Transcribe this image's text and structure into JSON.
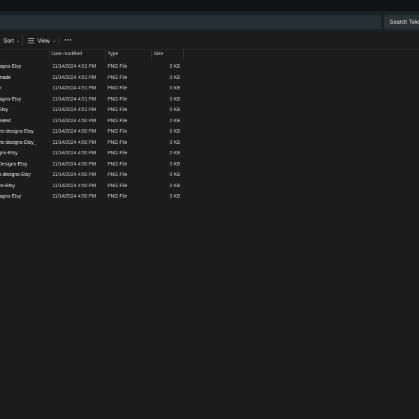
{
  "search": {
    "placeholder": "Search Tokens"
  },
  "toolbar": {
    "sort_label": "Sort",
    "view_label": "View",
    "more_label": "···"
  },
  "columns": {
    "name": "",
    "date": "Date modified",
    "type": "Type",
    "size": "Size"
  },
  "files": [
    {
      "name": "signs-Etsy",
      "date": "11/14/2024 4:51 PM",
      "type": "PNG File",
      "size": "0 KB"
    },
    {
      "name": "made",
      "date": "11/14/2024 4:51 PM",
      "type": "PNG File",
      "size": "0 KB"
    },
    {
      "name": "y",
      "date": "11/14/2024 4:51 PM",
      "type": "PNG File",
      "size": "0 KB"
    },
    {
      "name": "signs-Etsy",
      "date": "11/14/2024 4:51 PM",
      "type": "PNG File",
      "size": "0 KB"
    },
    {
      "name": "Etsy",
      "date": "11/14/2024 4:51 PM",
      "type": "PNG File",
      "size": "0 KB"
    },
    {
      "name": "eated",
      "date": "11/14/2024 4:50 PM",
      "type": "PNG File",
      "size": "0 KB"
    },
    {
      "name": "rts-designs-Etsy",
      "date": "11/14/2024 4:50 PM",
      "type": "PNG File",
      "size": "0 KB"
    },
    {
      "name": "rts-designs-Etsy_",
      "date": "11/14/2024 4:50 PM",
      "type": "PNG File",
      "size": "0 KB"
    },
    {
      "name": "gns-Etsy",
      "date": "11/14/2024 4:50 PM",
      "type": "PNG File",
      "size": "0 KB"
    },
    {
      "name": "Designs-Etsy",
      "date": "11/14/2024 4:50 PM",
      "type": "PNG File",
      "size": "0 KB"
    },
    {
      "name": "s-designs-Etsy",
      "date": "11/14/2024 4:50 PM",
      "type": "PNG File",
      "size": "0 KB"
    },
    {
      "name": "ns-Etsy",
      "date": "11/14/2024 4:50 PM",
      "type": "PNG File",
      "size": "0 KB"
    },
    {
      "name": "signs-Etsy",
      "date": "11/14/2024 4:50 PM",
      "type": "PNG File",
      "size": "0 KB"
    }
  ],
  "colors": {
    "background": "#1c1c1c",
    "titlebar": "#0f1215",
    "address_row": "#1b2226",
    "text": "#f0f0f0"
  }
}
